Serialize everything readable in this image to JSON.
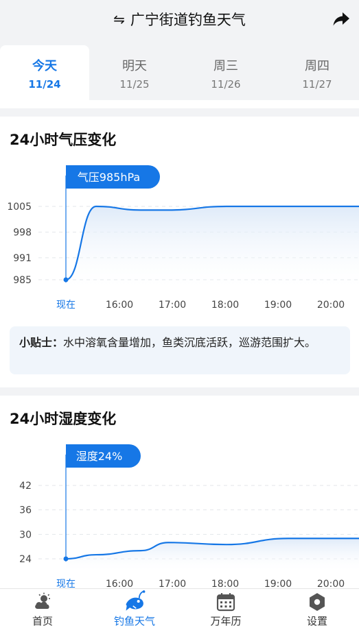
{
  "header": {
    "title": "广宁街道钓鱼天气",
    "swap_glyph": "⇋"
  },
  "tabs": [
    {
      "day": "今天",
      "date": "11/24",
      "active": true
    },
    {
      "day": "明天",
      "date": "11/25",
      "active": false
    },
    {
      "day": "周三",
      "date": "11/26",
      "active": false
    },
    {
      "day": "周四",
      "date": "11/27",
      "active": false
    }
  ],
  "pressure": {
    "title": "24小时气压变化",
    "badge": "气压985hPa",
    "tip_label": "小贴士：",
    "tip_text": "水中溶氧含量增加，鱼类沉底活跃，巡游范围扩大。"
  },
  "humidity": {
    "title": "24小时湿度变化",
    "badge": "湿度24%"
  },
  "nav": [
    {
      "label": "首页",
      "icon": "weather-icon",
      "active": false
    },
    {
      "label": "钓鱼天气",
      "icon": "fish-icon",
      "active": true
    },
    {
      "label": "万年历",
      "icon": "calendar-icon",
      "active": false
    },
    {
      "label": "设置",
      "icon": "settings-icon",
      "active": false
    }
  ],
  "colors": {
    "accent": "#1677e6",
    "background": "#f2f3f5"
  },
  "chart_data": [
    {
      "type": "line",
      "x": [
        "现在",
        "16:00",
        "17:00",
        "18:00",
        "19:00",
        "20:00"
      ],
      "yticks": [
        985,
        991,
        998,
        1005
      ],
      "ylim": [
        985,
        1005
      ],
      "series": [
        {
          "values": [
            985,
            1005,
            1004,
            1004,
            1005,
            1005
          ]
        }
      ]
    },
    {
      "type": "line",
      "x": [
        "现在",
        "16:00",
        "17:00",
        "18:00",
        "19:00",
        "20:00"
      ],
      "yticks": [
        24,
        30,
        36,
        42
      ],
      "ylim": [
        24,
        42
      ],
      "series": [
        {
          "values": [
            24,
            25,
            26,
            28,
            27.5,
            29
          ]
        }
      ]
    }
  ]
}
